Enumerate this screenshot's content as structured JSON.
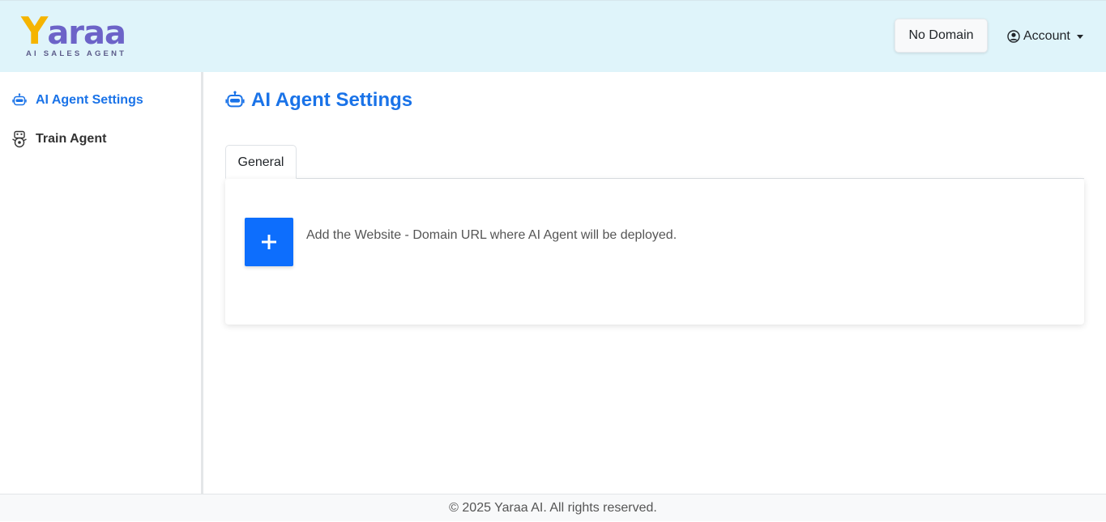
{
  "header": {
    "logo": {
      "word_first": "Y",
      "word_rest": "araa",
      "tagline": "AI SALES AGENT"
    },
    "no_domain_label": "No Domain",
    "account_label": "Account"
  },
  "sidebar": {
    "items": [
      {
        "label": "AI Agent Settings",
        "icon": "robot-icon",
        "active": true
      },
      {
        "label": "Train Agent",
        "icon": "train-robot-icon",
        "active": false
      }
    ]
  },
  "main": {
    "title": "AI Agent Settings",
    "tabs": [
      {
        "label": "General"
      }
    ],
    "add_website_text": "Add the Website - Domain URL where AI Agent will be deployed."
  },
  "footer": {
    "text": "© 2025 Yaraa AI. All rights reserved."
  },
  "colors": {
    "accent": "#1a73e8",
    "button_primary": "#0d6efd",
    "header_bg": "#dff4fa",
    "logo_yellow": "#f5b400",
    "logo_purple": "#6c63c8"
  }
}
